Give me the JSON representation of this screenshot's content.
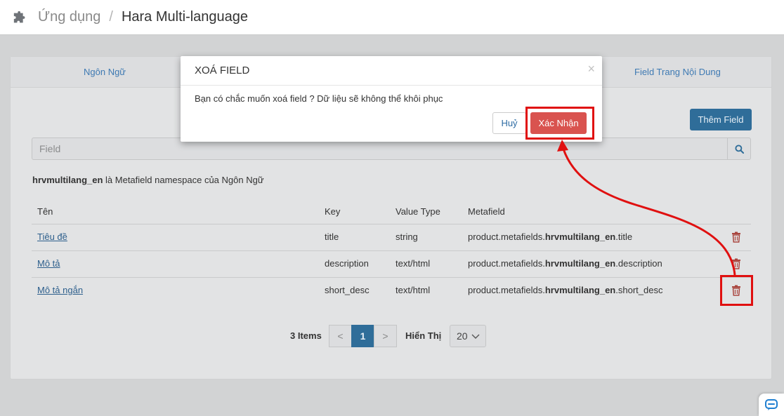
{
  "header": {
    "breadcrumb_app": "Ứng dụng",
    "breadcrumb_sep": "/",
    "page_title": "Hara Multi-language"
  },
  "tabs": [
    {
      "label": "Ngôn Ngữ"
    },
    {
      "label": "Field Trang Nội Dung"
    }
  ],
  "add_button": "Thêm Field",
  "search": {
    "placeholder": "Field"
  },
  "namespace_note": {
    "bold": "hrvmultilang_en",
    "rest": " là Metafield namespace của Ngôn Ngữ"
  },
  "table": {
    "headers": [
      "Tên",
      "Key",
      "Value Type",
      "Metafield"
    ],
    "rows": [
      {
        "name": "Tiêu đề",
        "key": "title",
        "type": "string",
        "mf_prefix": "product.metafields.",
        "mf_ns": "hrvmultilang_en",
        "mf_suffix": ".title"
      },
      {
        "name": "Mô tả",
        "key": "description",
        "type": "text/html",
        "mf_prefix": "product.metafields.",
        "mf_ns": "hrvmultilang_en",
        "mf_suffix": ".description"
      },
      {
        "name": "Mô tả ngắn",
        "key": "short_desc",
        "type": "text/html",
        "mf_prefix": "product.metafields.",
        "mf_ns": "hrvmultilang_en",
        "mf_suffix": ".short_desc"
      }
    ]
  },
  "pagination": {
    "count": "3 Items",
    "prev": "<",
    "page": "1",
    "next": ">",
    "show_label": "Hiển Thị",
    "page_size": "20"
  },
  "modal": {
    "title": "XOÁ FIELD",
    "close": "×",
    "message": "Bạn có chắc muốn xoá field ? Dữ liệu sẽ không thể khôi phục",
    "cancel": "Huỷ",
    "confirm": "Xác Nhận"
  },
  "colors": {
    "primary": "#2f6d99",
    "danger": "#d9534f",
    "annotation": "#e01010"
  }
}
